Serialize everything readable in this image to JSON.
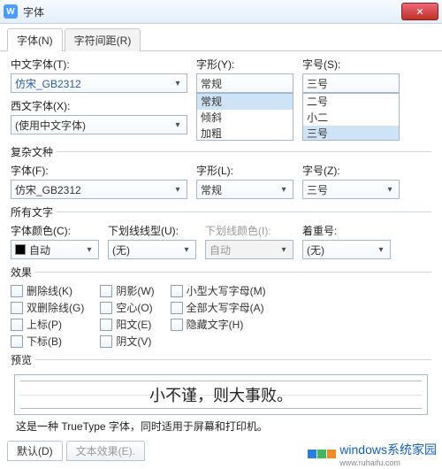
{
  "window": {
    "app_icon": "W",
    "title": "字体",
    "close_glyph": "✕"
  },
  "tabs": {
    "font": "字体(N)",
    "spacing": "字符间距(R)"
  },
  "section1": {
    "cn_font_label": "中文字体(T):",
    "cn_font_value": "仿宋_GB2312",
    "style_label": "字形(Y):",
    "style_value": "常规",
    "style_options": [
      "常规",
      "倾斜",
      "加粗"
    ],
    "size_label": "字号(S):",
    "size_value": "三号",
    "size_options": [
      "二号",
      "小二",
      "三号"
    ],
    "west_font_label": "西文字体(X):",
    "west_font_value": "(使用中文字体)"
  },
  "complex": {
    "group_label": "复杂文种",
    "font_label": "字体(F):",
    "font_value": "仿宋_GB2312",
    "style_label": "字形(L):",
    "style_value": "常规",
    "size_label": "字号(Z):",
    "size_value": "三号"
  },
  "all_text": {
    "group_label": "所有文字",
    "color_label": "字体颜色(C):",
    "color_value": "自动",
    "underline_label": "下划线线型(U):",
    "underline_value": "(无)",
    "ul_color_label": "下划线颜色(I):",
    "ul_color_value": "自动",
    "emphasis_label": "着重号:",
    "emphasis_value": "(无)"
  },
  "effects": {
    "group_label": "效果",
    "col1": [
      "删除线(K)",
      "双删除线(G)",
      "上标(P)",
      "下标(B)"
    ],
    "col2": [
      "阴影(W)",
      "空心(O)",
      "阳文(E)",
      "阴文(V)"
    ],
    "col3": [
      "小型大写字母(M)",
      "全部大写字母(A)",
      "隐藏文字(H)"
    ]
  },
  "preview": {
    "group_label": "预览",
    "sample": "小不谨，则大事败。",
    "hint": "这是一种 TrueType 字体，同时适用于屏幕和打印机。"
  },
  "bottom_tabs": {
    "default": "默认(D)",
    "text_effect": "文本效果(E)."
  },
  "watermark": {
    "text": "windows系统家园",
    "url": "www.ruhaifu.com"
  }
}
